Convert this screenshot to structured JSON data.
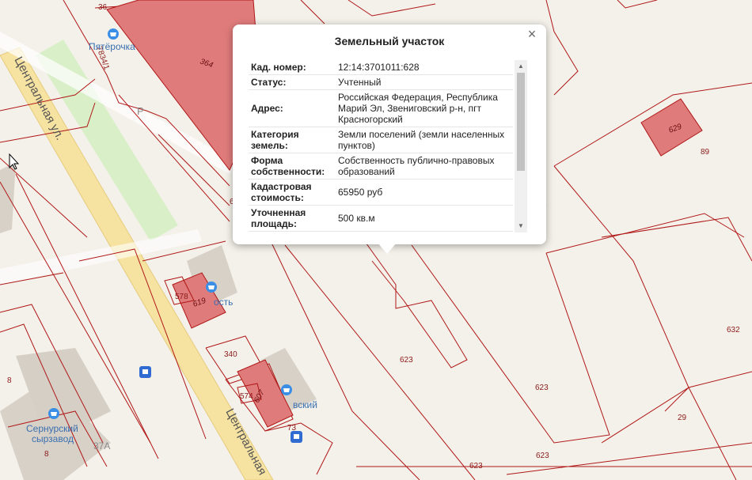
{
  "map": {
    "street_label_1": "Центральная ул.",
    "street_label_2": "Центральная",
    "parcel_labels": {
      "p364": "364",
      "p629": "629",
      "p89": "89",
      "p578": "578",
      "p619": "619",
      "p340": "340",
      "p574": "574",
      "p607": "607",
      "p623a": "623",
      "p623b": "623",
      "p623c": "623",
      "p623d": "623",
      "p632": "632",
      "p29": "29",
      "p73": "73",
      "p8a": "8",
      "p8b": "8",
      "p367": "36",
      "p7834": "7834/1",
      "p6": "6"
    },
    "poi": {
      "pyaterochka": "Пятёрочка",
      "sernur_line1": "Сернурский",
      "sernur_line2": "сырзавод",
      "shop_partial": "вский",
      "shop_partial2": "ость"
    },
    "house_number": "37А",
    "parking_letter": "P",
    "colors": {
      "parcel_fill": "#e07b7b",
      "parcel_stroke": "#b01818",
      "road_yellow": "#f7e3a1",
      "green_area": "#d9efc8"
    }
  },
  "popup": {
    "title": "Земельный участок",
    "close": "×",
    "rows": [
      {
        "key": "Кад. номер:",
        "value": "12:14:3701011:628"
      },
      {
        "key": "Статус:",
        "value": "Учтенный"
      },
      {
        "key": "Адрес:",
        "value": "Российская Федерация, Республика Марий Эл, Звениговский р-н, пгт Красногорский"
      },
      {
        "key": "Категория земель:",
        "value": "Земли поселений (земли населенных пунктов)"
      },
      {
        "key": "Форма собственности:",
        "value": "Собственность публично-правовых образований"
      },
      {
        "key": "Кадастровая стоимость:",
        "value": "65950 руб"
      },
      {
        "key": "Уточненная площадь:",
        "value": "500 кв.м"
      }
    ],
    "scroll_up": "▲",
    "scroll_down": "▼"
  }
}
